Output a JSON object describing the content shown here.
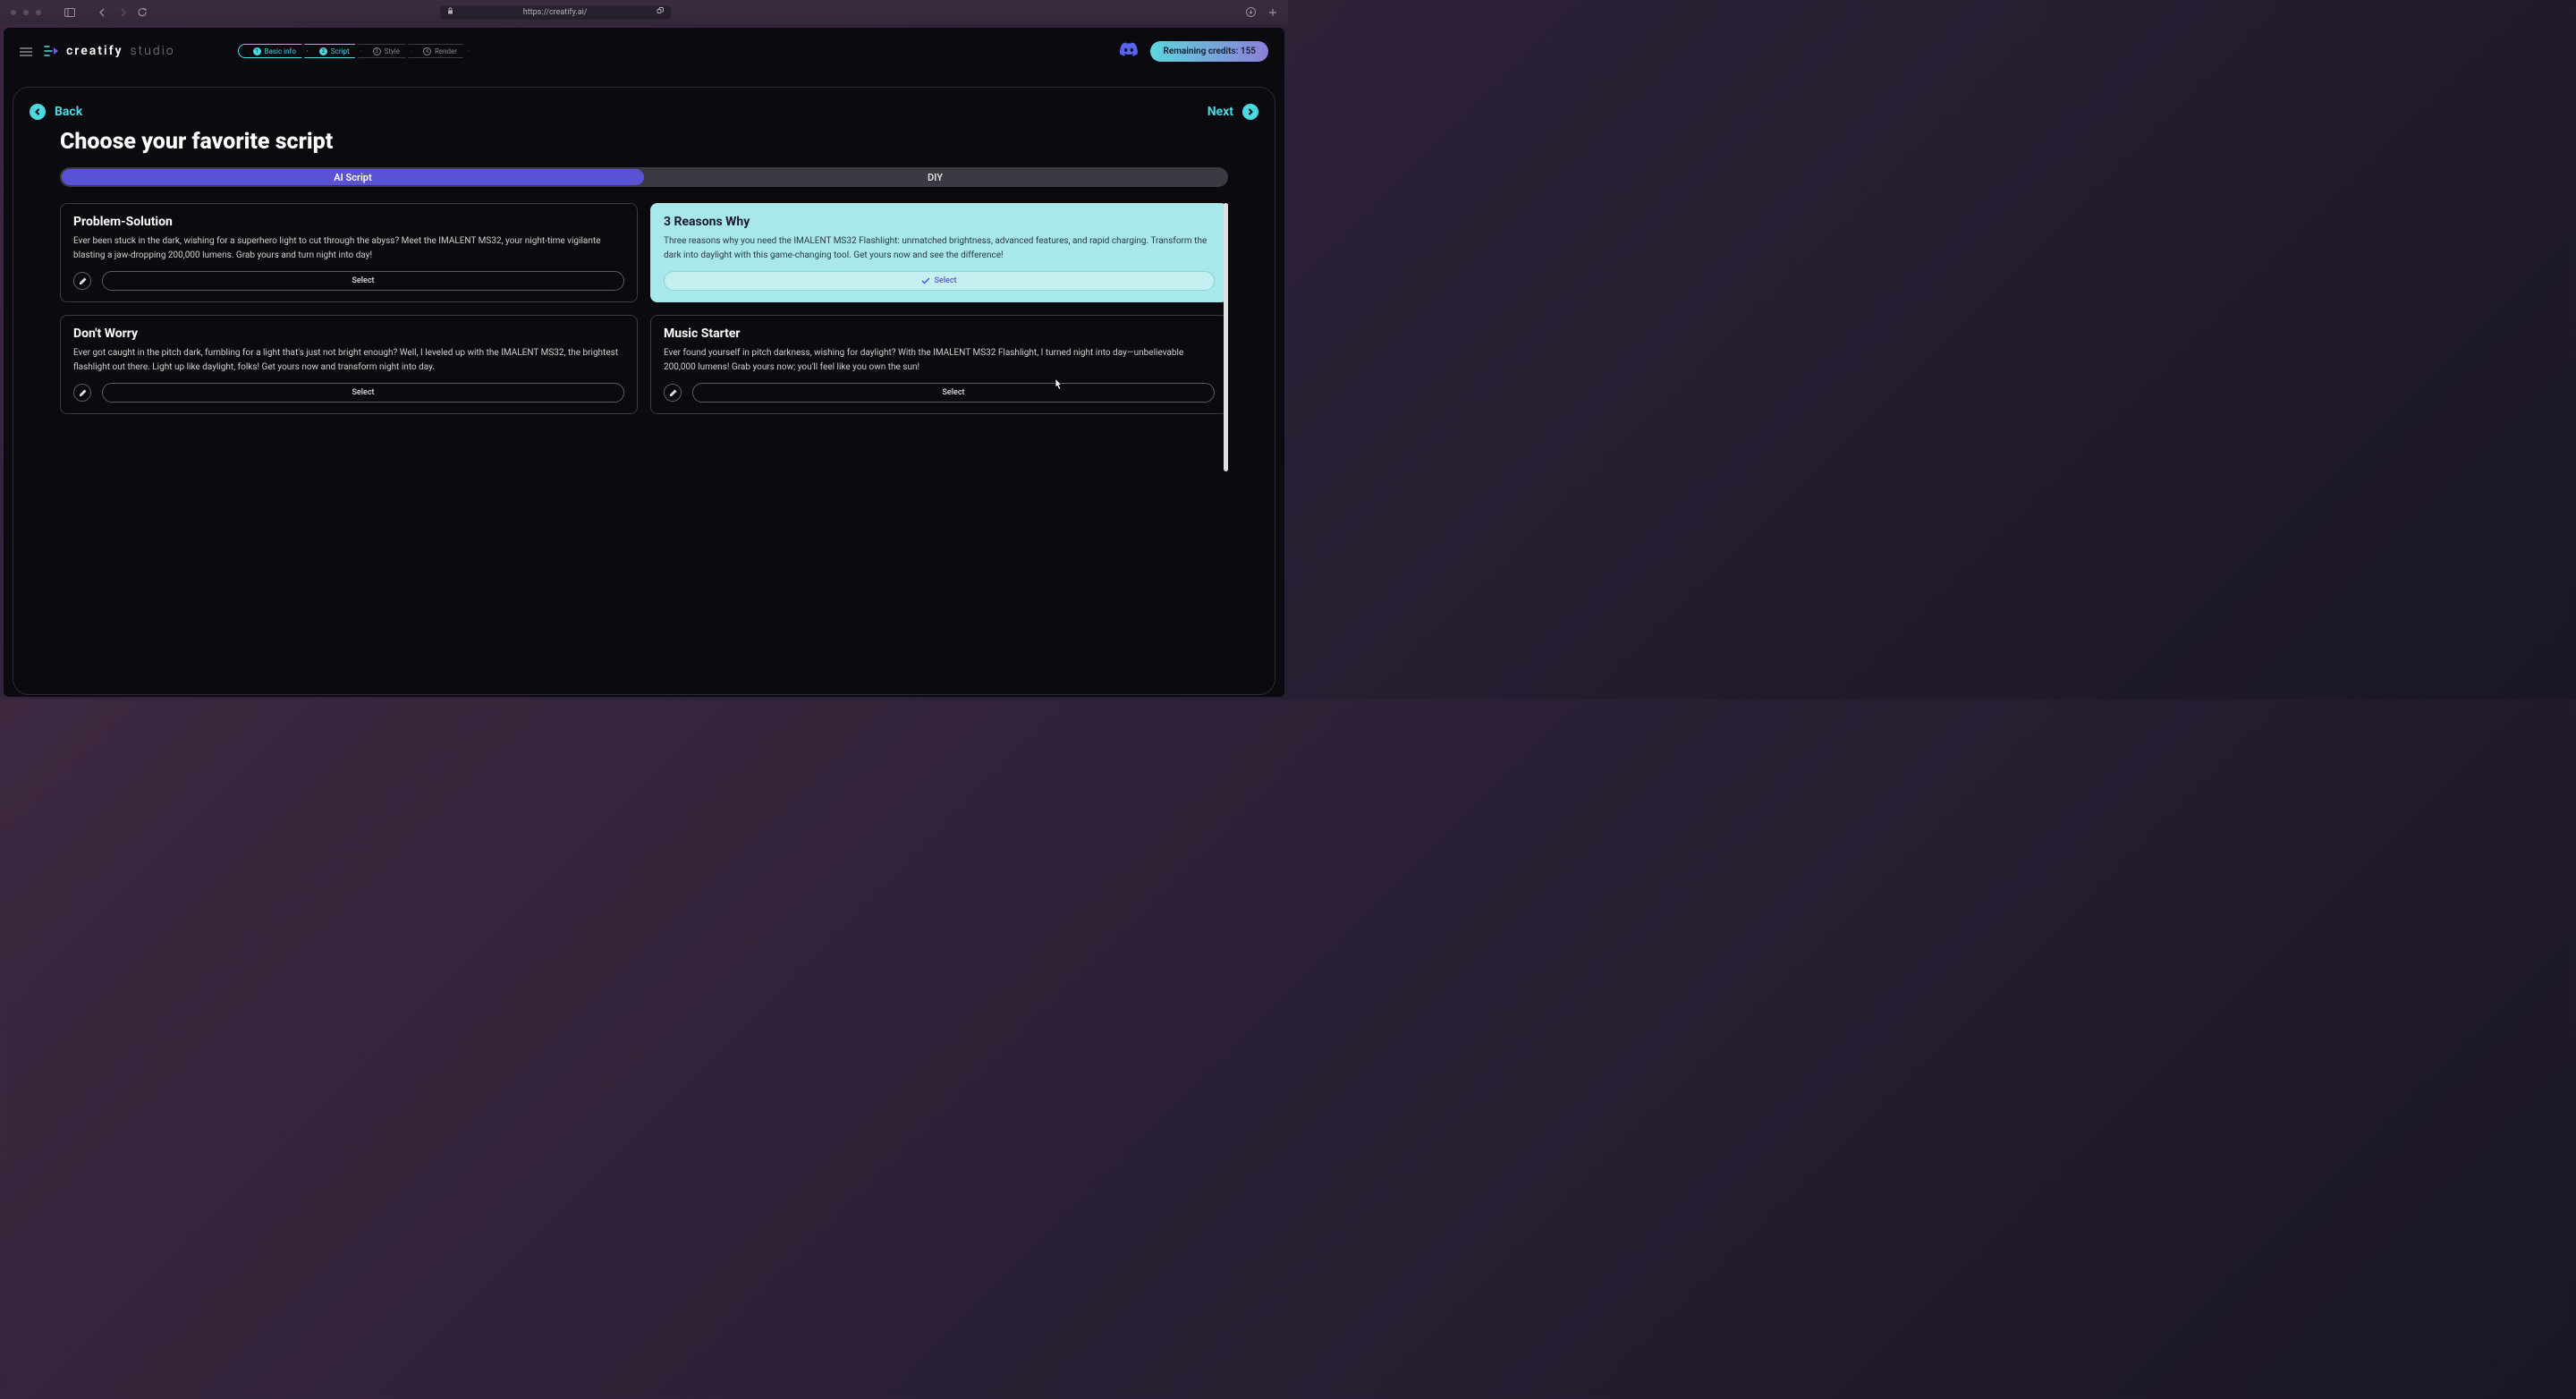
{
  "browser": {
    "url": "https://creatify.ai/"
  },
  "header": {
    "logo": {
      "main": "creatify",
      "sub": "studio"
    },
    "steps": [
      {
        "num": "1",
        "label": "Basic info",
        "state": "done"
      },
      {
        "num": "2",
        "label": "Script",
        "state": "active"
      },
      {
        "num": "3",
        "label": "Style",
        "state": ""
      },
      {
        "num": "4",
        "label": "Render",
        "state": ""
      }
    ],
    "credits": "Remaining credits: 155"
  },
  "nav": {
    "back": "Back",
    "next": "Next"
  },
  "page": {
    "title": "Choose your favorite script",
    "tabs": [
      {
        "label": "AI Script",
        "active": true
      },
      {
        "label": "DIY",
        "active": false
      }
    ],
    "select_label": "Select",
    "cards": [
      {
        "title": "Problem-Solution",
        "body": "Ever been stuck in the dark, wishing for a superhero light to cut through the abyss? Meet the IMALENT MS32, your night-time vigilante blasting a jaw-dropping 200,000 lumens. Grab yours and turn night into day!",
        "selected": false
      },
      {
        "title": "3 Reasons Why",
        "body": "Three reasons why you need the IMALENT MS32 Flashlight: unmatched brightness, advanced features, and rapid charging. Transform the dark into daylight with this game-changing tool. Get yours now and see the difference!",
        "selected": true
      },
      {
        "title": "Don't Worry",
        "body": "Ever got caught in the pitch dark, fumbling for a light that's just not bright enough? Well, I leveled up with the IMALENT MS32, the brightest flashlight out there. Light up like daylight, folks! Get yours now and transform night into day.",
        "selected": false
      },
      {
        "title": "Music Starter",
        "body": "Ever found yourself in pitch darkness, wishing for daylight? With the IMALENT MS32 Flashlight, I turned night into day—unbelievable 200,000 lumens! Grab yours now; you'll feel like you own the sun!",
        "selected": false
      }
    ]
  }
}
